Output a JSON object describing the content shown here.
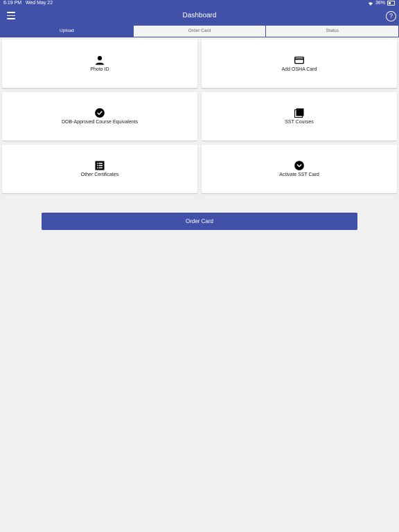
{
  "status_bar": {
    "time": "6:19 PM",
    "date": "Wed May 22",
    "battery": "36%"
  },
  "header": {
    "title": "Dashboard",
    "menu_icon": "hamburger-menu-icon",
    "help_icon": "help-circle-icon",
    "help_glyph": "?"
  },
  "tabs": [
    {
      "label": "Upload",
      "active": true
    },
    {
      "label": "Order Card",
      "active": false
    },
    {
      "label": "Status",
      "active": false
    }
  ],
  "cards": [
    {
      "label": "Photo ID",
      "icon": "person-icon"
    },
    {
      "label": "Add OSHA Card",
      "icon": "credit-card-icon"
    },
    {
      "label": "DOB-Approved Course Equivalents",
      "icon": "check-circle-icon"
    },
    {
      "label": "SST Courses",
      "icon": "stack-icon"
    },
    {
      "label": "Other Certificates",
      "icon": "list-icon"
    },
    {
      "label": "Activate SST Card",
      "icon": "chevron-circle-icon"
    }
  ],
  "order_button": {
    "label": "Order Card"
  },
  "colors": {
    "primary": "#4150a8",
    "background": "#f0f0f0",
    "card": "#ffffff"
  }
}
